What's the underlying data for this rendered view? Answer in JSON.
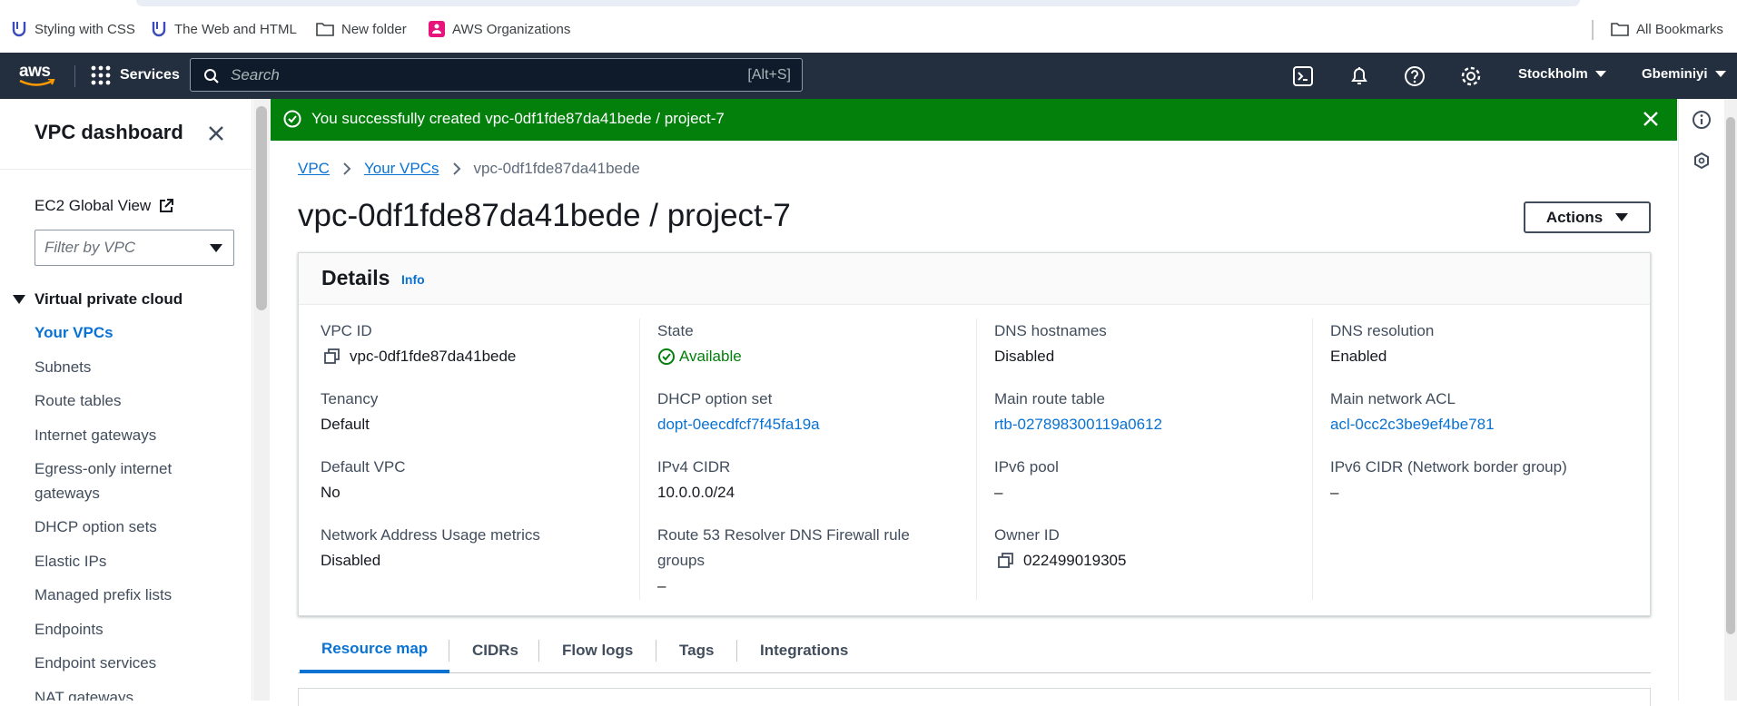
{
  "bookmarks": [
    {
      "label": "Styling with CSS",
      "icon": "udacity-icon"
    },
    {
      "label": "The Web and HTML",
      "icon": "udacity-icon"
    },
    {
      "label": "New folder",
      "icon": "folder-icon"
    },
    {
      "label": "AWS Organizations",
      "icon": "aws-org-icon"
    }
  ],
  "all_bookmarks": "All Bookmarks",
  "topnav": {
    "logo": "aws",
    "services": "Services",
    "search_placeholder": "Search",
    "search_shortcut": "[Alt+S]",
    "region": "Stockholm",
    "user": "Gbeminiyi"
  },
  "sidenav": {
    "title": "VPC dashboard",
    "ec2_global_view": "EC2 Global View",
    "filter_placeholder": "Filter by VPC",
    "section": "Virtual private cloud",
    "items": [
      "Your VPCs",
      "Subnets",
      "Route tables",
      "Internet gateways",
      "Egress-only internet gateways",
      "DHCP option sets",
      "Elastic IPs",
      "Managed prefix lists",
      "Endpoints",
      "Endpoint services",
      "NAT gateways"
    ],
    "active_item": "Your VPCs"
  },
  "flash": {
    "message": "You successfully created vpc-0df1fde87da41bede / project-7",
    "color": "#037f0c"
  },
  "breadcrumb": [
    "VPC",
    "Your VPCs",
    "vpc-0df1fde87da41bede"
  ],
  "page_title": "vpc-0df1fde87da41bede / project-7",
  "actions_label": "Actions",
  "details": {
    "heading": "Details",
    "info": "Info",
    "columns": [
      [
        {
          "label": "VPC ID",
          "value": "vpc-0df1fde87da41bede",
          "copy": true
        },
        {
          "label": "Tenancy",
          "value": "Default"
        },
        {
          "label": "Default VPC",
          "value": "No"
        },
        {
          "label": "Network Address Usage metrics",
          "value": "Disabled"
        }
      ],
      [
        {
          "label": "State",
          "value": "Available",
          "status": true
        },
        {
          "label": "DHCP option set",
          "value": "dopt-0eecdfcf7f45fa19a",
          "link": true
        },
        {
          "label": "IPv4 CIDR",
          "value": "10.0.0.0/24"
        },
        {
          "label": "Route 53 Resolver DNS Firewall rule groups",
          "value": "–"
        }
      ],
      [
        {
          "label": "DNS hostnames",
          "value": "Disabled"
        },
        {
          "label": "Main route table",
          "value": "rtb-027898300119a0612",
          "link": true
        },
        {
          "label": "IPv6 pool",
          "value": "–"
        },
        {
          "label": "Owner ID",
          "value": "022499019305",
          "copy": true
        }
      ],
      [
        {
          "label": "DNS resolution",
          "value": "Enabled"
        },
        {
          "label": "Main network ACL",
          "value": "acl-0cc2c3be9ef4be781",
          "link": true
        },
        {
          "label": "IPv6 CIDR (Network border group)",
          "value": "–"
        }
      ]
    ]
  },
  "tabs": [
    "Resource map",
    "CIDRs",
    "Flow logs",
    "Tags",
    "Integrations"
  ],
  "active_tab": "Resource map",
  "colors": {
    "link": "#0972d3",
    "nav_bg": "#232f3e",
    "success": "#037f0c"
  }
}
